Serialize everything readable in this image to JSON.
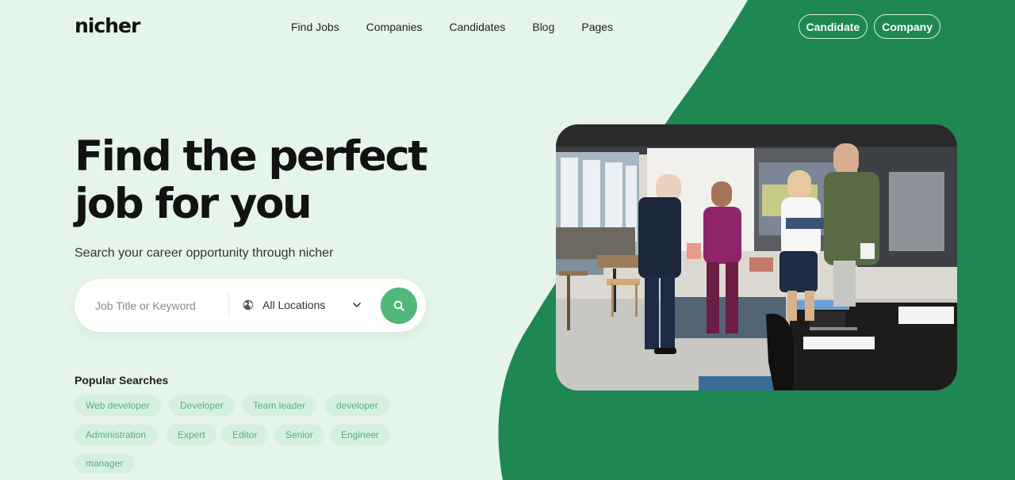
{
  "brand": {
    "logo": "nicher"
  },
  "nav": {
    "items": [
      {
        "label": "Find Jobs"
      },
      {
        "label": "Companies"
      },
      {
        "label": "Candidates"
      },
      {
        "label": "Blog"
      },
      {
        "label": "Pages"
      }
    ],
    "auth": {
      "candidate": "Candidate",
      "company": "Company"
    }
  },
  "hero": {
    "title_line1": "Find the perfect",
    "title_line2": "job for you",
    "subtitle": "Search your career opportunity through nicher"
  },
  "search": {
    "keyword_placeholder": "Job Title or Keyword",
    "location": "All Locations",
    "location_icon": "globe-icon",
    "dropdown_icon": "chevron-down-icon",
    "submit_icon": "search-icon"
  },
  "popular": {
    "title": "Popular Searches",
    "tags": [
      "Web developer",
      "Developer",
      "Team leader",
      "developer",
      "Administration",
      "Expert",
      "Editor",
      "Senior",
      "Engineer",
      "manager"
    ]
  },
  "colors": {
    "background": "#e5f5ea",
    "brand_green": "#1f8752",
    "accent_green": "#50b87a",
    "tag_bg": "#d6efdf",
    "tag_text": "#56b07f"
  }
}
